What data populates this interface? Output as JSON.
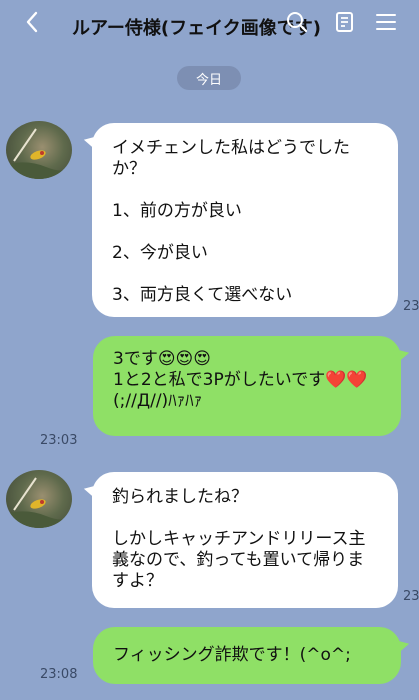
{
  "header": {
    "back_icon": "chevron-left-icon",
    "title": "ルアー侍様(フェイク画像です)",
    "search_icon": "search-icon",
    "notes_icon": "notes-icon",
    "menu_icon": "menu-icon"
  },
  "date_divider": "今日",
  "messages": [
    {
      "side": "incoming",
      "text": "イメチェンした私はどうでしたか？\n\n1、前の方が良い\n\n2、今が良い\n\n3、両方良くて選べない",
      "time": "23"
    },
    {
      "side": "outgoing",
      "text": "3です😍😍😍\n1と2と私で3Pがしたいです❤️❤️\n(;//Д//)ﾊｧﾊｧ",
      "time": "23:03"
    },
    {
      "side": "incoming",
      "text": "釣られましたね？\n\nしかしキャッチアンドリリース主義なので、釣っても置いて帰りますよ？",
      "time": "23"
    },
    {
      "side": "outgoing",
      "text": "フィッシング詐欺です！(^o^;",
      "time": "23:08"
    }
  ],
  "colors": {
    "background": "#8fa5cc",
    "incoming_bubble": "#ffffff",
    "outgoing_bubble": "#8fe066",
    "date_pill": "#7d8fb3"
  }
}
